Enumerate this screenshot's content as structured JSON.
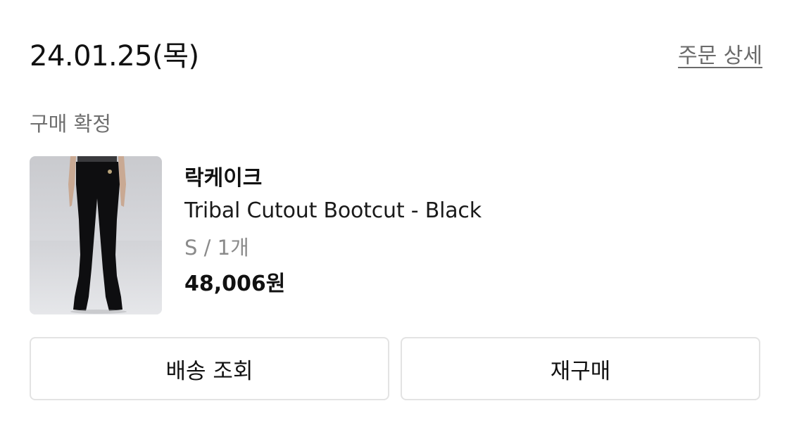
{
  "order": {
    "date": "24.01.25(목)",
    "detail_link": "주문 상세",
    "status": "구매 확정"
  },
  "product": {
    "brand": "락케이크",
    "name": "Tribal Cutout Bootcut - Black",
    "option": "S / 1개",
    "price": "48,006원"
  },
  "actions": {
    "track_label": "배송 조회",
    "reorder_label": "재구매"
  }
}
